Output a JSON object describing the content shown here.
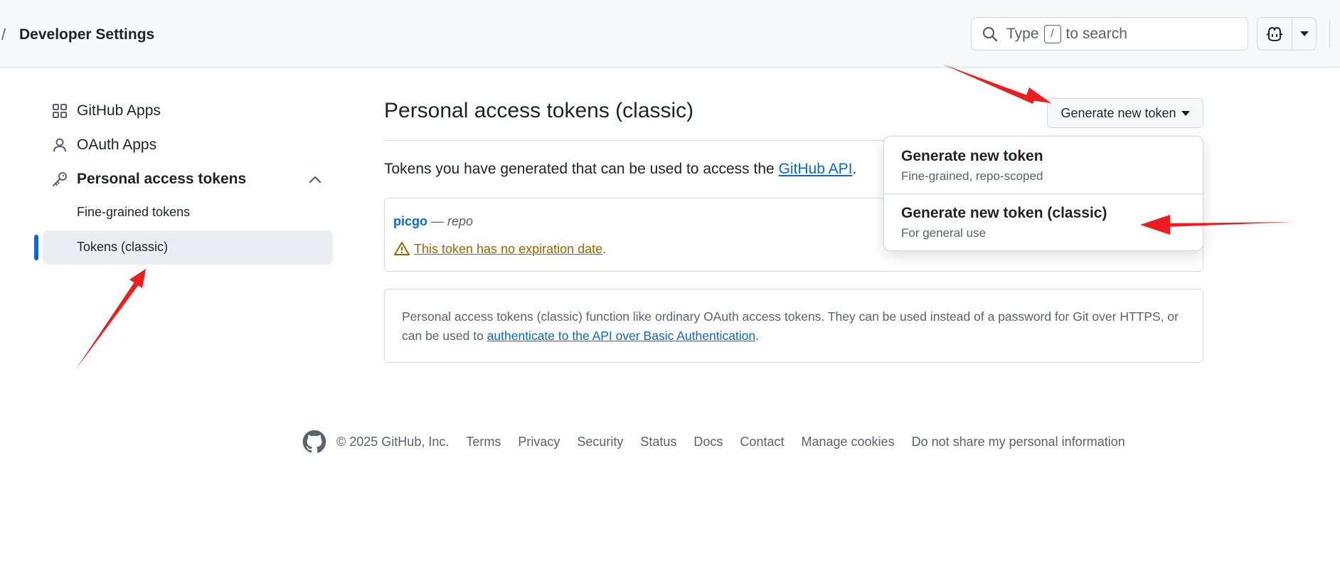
{
  "header": {
    "breadcrumb_separator": "/",
    "title": "Developer Settings",
    "search": {
      "prefix": "Type",
      "key": "/",
      "suffix": "to search"
    }
  },
  "sidebar": {
    "items": [
      {
        "label": "GitHub Apps",
        "icon": "apps-grid-icon"
      },
      {
        "label": "OAuth Apps",
        "icon": "person-icon"
      },
      {
        "label": "Personal access tokens",
        "icon": "key-icon",
        "expanded": true
      }
    ],
    "sub_items": [
      {
        "label": "Fine-grained tokens",
        "active": false
      },
      {
        "label": "Tokens (classic)",
        "active": true
      }
    ]
  },
  "main": {
    "title": "Personal access tokens (classic)",
    "generate_button": "Generate new token",
    "intro_text": "Tokens you have generated that can be used to access the ",
    "intro_link": "GitHub API",
    "intro_end": ".",
    "token": {
      "name": "picgo",
      "scope_sep": " — ",
      "scope": "repo",
      "warning": "This token has no expiration date",
      "warning_end": "."
    },
    "note": {
      "text": "Personal access tokens (classic) function like ordinary OAuth access tokens. They can be used instead of a password for Git over HTTPS, or can be used to ",
      "link": "authenticate to the API over Basic Authentication",
      "end": "."
    }
  },
  "menu": {
    "items": [
      {
        "title": "Generate new token",
        "desc": "Fine-grained, repo-scoped"
      },
      {
        "title": "Generate new token (classic)",
        "desc": "For general use"
      }
    ]
  },
  "footer": {
    "copyright": "© 2025 GitHub, Inc.",
    "links": [
      "Terms",
      "Privacy",
      "Security",
      "Status",
      "Docs",
      "Contact",
      "Manage cookies",
      "Do not share my personal information"
    ]
  },
  "colors": {
    "accent": "#0969da",
    "warning": "#9a6700",
    "annotation_arrow": "#ee1c1c"
  }
}
